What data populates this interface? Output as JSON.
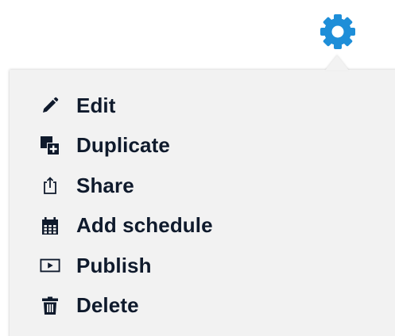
{
  "colors": {
    "gear": "#1E8ED8",
    "menu_bg": "#F2F2F2",
    "text": "#0F1A2C",
    "marker": "#E53935"
  },
  "gear": {
    "icon": "gear-icon"
  },
  "menu": {
    "items": [
      {
        "label": "Edit",
        "icon": "pencil-icon"
      },
      {
        "label": "Duplicate",
        "icon": "duplicate-icon"
      },
      {
        "label": "Share",
        "icon": "share-icon"
      },
      {
        "label": "Add schedule",
        "icon": "calendar-icon"
      },
      {
        "label": "Publish",
        "icon": "play-icon"
      },
      {
        "label": "Delete",
        "icon": "trash-icon"
      }
    ]
  }
}
